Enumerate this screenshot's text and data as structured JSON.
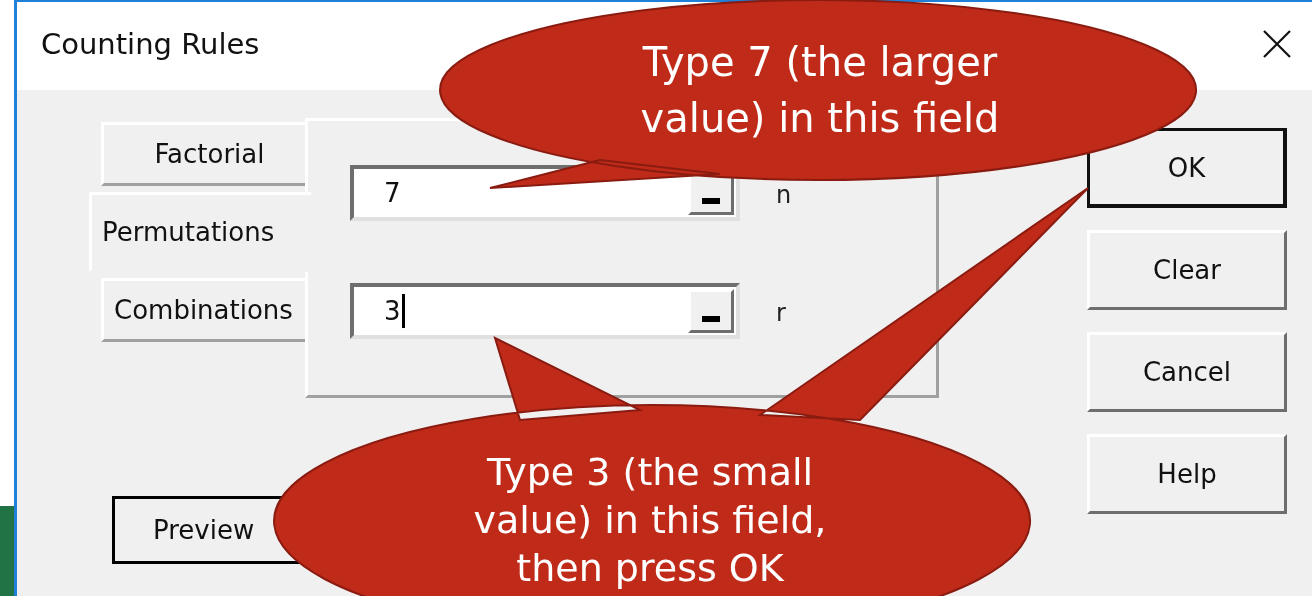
{
  "window": {
    "title": "Counting Rules"
  },
  "tabs": [
    {
      "label": "Factorial",
      "selected": false
    },
    {
      "label": "Permutations",
      "selected": true
    },
    {
      "label": "Combinations",
      "selected": false
    }
  ],
  "fields": [
    {
      "value": "7",
      "label": "n",
      "focused": false
    },
    {
      "value": "3",
      "label": "r",
      "focused": true
    }
  ],
  "buttons": [
    {
      "label": "OK",
      "default": true
    },
    {
      "label": "Clear",
      "default": false
    },
    {
      "label": "Cancel",
      "default": false
    },
    {
      "label": "Help",
      "default": false
    }
  ],
  "preview_button": {
    "label": "Preview"
  },
  "callouts": [
    {
      "text": "Type 7 (the larger value) in this field"
    },
    {
      "text": "Type 3 (the small value) in this field, then press OK"
    }
  ]
}
